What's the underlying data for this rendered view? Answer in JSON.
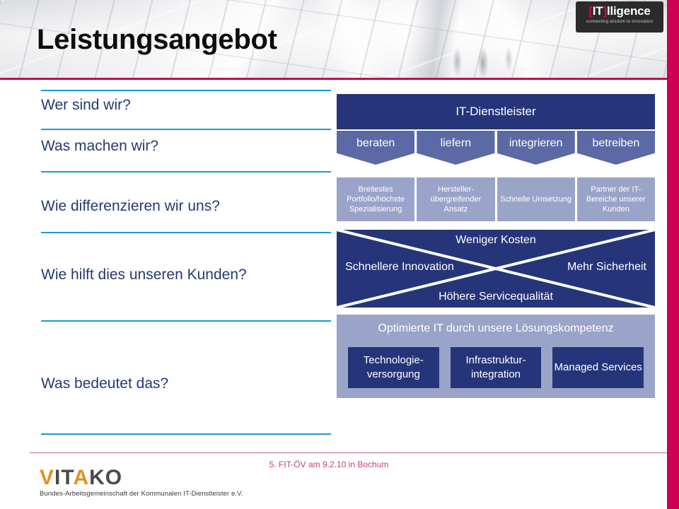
{
  "header": {
    "title": "Leistungsangebot",
    "logo": {
      "bracket_open": "[",
      "it": "IT",
      "bracket_close": "]",
      "rest": "lligence",
      "tagline": "connecting wisdom to innovation"
    }
  },
  "questions": [
    {
      "label": "Wer sind wir?"
    },
    {
      "label": "Was machen wir?"
    },
    {
      "label": "Wie differenzieren wir uns?"
    },
    {
      "label": "Wie hilft dies unseren Kunden?"
    },
    {
      "label": "Was bedeutet das?"
    }
  ],
  "diagram": {
    "band_top": "IT-Dienstleister",
    "chevrons": [
      {
        "label": "beraten"
      },
      {
        "label": "liefern"
      },
      {
        "label": "integrieren"
      },
      {
        "label": "betreiben"
      }
    ],
    "features": [
      {
        "label": "Breitestes Portfolio/höchste Spezialisierung"
      },
      {
        "label": "Hersteller-übergreifender Ansatz"
      },
      {
        "label": "Schnelle Umsetzung"
      },
      {
        "label": "Partner der IT-Bereiche unserer Kunden"
      }
    ],
    "benefits": {
      "top": "Weniger Kosten",
      "left": "Schnellere Innovation",
      "right": "Mehr Sicherheit",
      "bottom": "Höhere Servicequalität"
    },
    "outcome": {
      "title": "Optimierte IT durch unsere Lösungskompetenz",
      "boxes": [
        {
          "label": "Technologie-versorgung"
        },
        {
          "label": "Infrastruktur-integration"
        },
        {
          "label": "Managed Services"
        }
      ]
    }
  },
  "footer": {
    "event": "5. FIT-ÖV am 9.2.10 in Bochum",
    "vitako": {
      "v": "V",
      "it": "IT",
      "a": "A",
      "ko": "KO",
      "subtitle": "Bundes-Arbeitsgemeinschaft der Kommunalen IT-Dienstleister e.V."
    }
  },
  "colors": {
    "navy": "#26357a",
    "mid_blue": "#5b6aa5",
    "light_blue": "#9aa4c8",
    "rule_blue": "#1b9ad6",
    "question_text": "#243a73",
    "pink": "#cc0055",
    "event_pink": "#c0456f",
    "logo_accent": "#e4004c",
    "vitako_orange": "#e2911f"
  }
}
